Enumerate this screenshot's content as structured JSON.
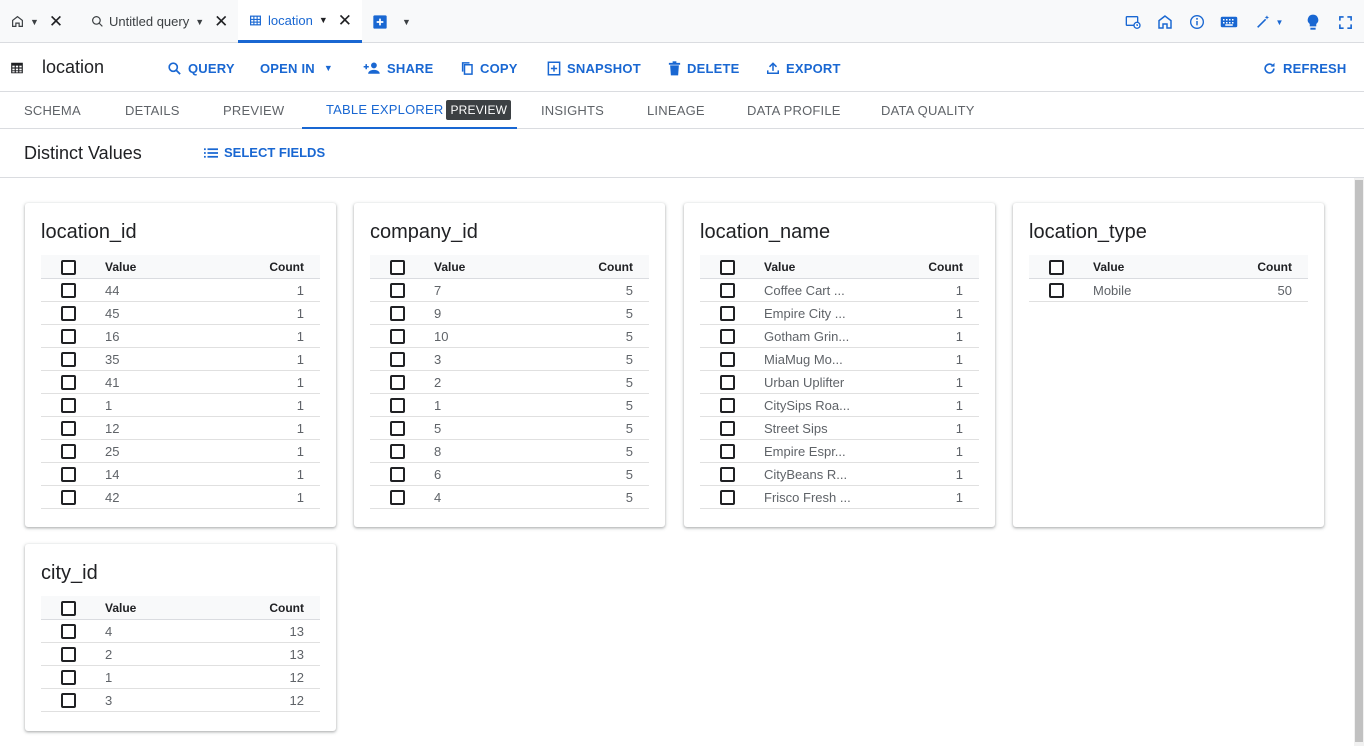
{
  "tabs": [
    {
      "label": "",
      "kind": "home"
    },
    {
      "label": "Untitled query",
      "kind": "query"
    },
    {
      "label": "location",
      "kind": "table",
      "active": true
    }
  ],
  "toolbar": {
    "title": "location",
    "buttons": {
      "query": "QUERY",
      "open_in": "OPEN IN",
      "share": "SHARE",
      "copy": "COPY",
      "snapshot": "SNAPSHOT",
      "delete": "DELETE",
      "export": "EXPORT",
      "refresh": "REFRESH"
    }
  },
  "subtabs": {
    "schema": "SCHEMA",
    "details": "DETAILS",
    "preview": "PREVIEW",
    "table_explorer": "TABLE EXPLORER",
    "table_explorer_badge": "PREVIEW",
    "insights": "INSIGHTS",
    "lineage": "LINEAGE",
    "data_profile": "DATA PROFILE",
    "data_quality": "DATA QUALITY"
  },
  "section": {
    "title": "Distinct Values",
    "select_fields": "SELECT FIELDS"
  },
  "table_headers": {
    "value": "Value",
    "count": "Count"
  },
  "cards": [
    {
      "title": "location_id",
      "rows": [
        {
          "value": "44",
          "count": "1"
        },
        {
          "value": "45",
          "count": "1"
        },
        {
          "value": "16",
          "count": "1"
        },
        {
          "value": "35",
          "count": "1"
        },
        {
          "value": "41",
          "count": "1"
        },
        {
          "value": "1",
          "count": "1"
        },
        {
          "value": "12",
          "count": "1"
        },
        {
          "value": "25",
          "count": "1"
        },
        {
          "value": "14",
          "count": "1"
        },
        {
          "value": "42",
          "count": "1"
        }
      ]
    },
    {
      "title": "company_id",
      "rows": [
        {
          "value": "7",
          "count": "5"
        },
        {
          "value": "9",
          "count": "5"
        },
        {
          "value": "10",
          "count": "5"
        },
        {
          "value": "3",
          "count": "5"
        },
        {
          "value": "2",
          "count": "5"
        },
        {
          "value": "1",
          "count": "5"
        },
        {
          "value": "5",
          "count": "5"
        },
        {
          "value": "8",
          "count": "5"
        },
        {
          "value": "6",
          "count": "5"
        },
        {
          "value": "4",
          "count": "5"
        }
      ]
    },
    {
      "title": "location_name",
      "rows": [
        {
          "value": "Coffee Cart ...",
          "count": "1"
        },
        {
          "value": "Empire City ...",
          "count": "1"
        },
        {
          "value": "Gotham Grin...",
          "count": "1"
        },
        {
          "value": "MiaMug Mo...",
          "count": "1"
        },
        {
          "value": "Urban Uplifter",
          "count": "1"
        },
        {
          "value": "CitySips Roa...",
          "count": "1"
        },
        {
          "value": "Street Sips",
          "count": "1"
        },
        {
          "value": "Empire Espr...",
          "count": "1"
        },
        {
          "value": "CityBeans R...",
          "count": "1"
        },
        {
          "value": "Frisco Fresh ...",
          "count": "1"
        }
      ]
    },
    {
      "title": "location_type",
      "rows": [
        {
          "value": "Mobile",
          "count": "50"
        }
      ]
    },
    {
      "title": "city_id",
      "rows": [
        {
          "value": "4",
          "count": "13"
        },
        {
          "value": "2",
          "count": "13"
        },
        {
          "value": "1",
          "count": "12"
        },
        {
          "value": "3",
          "count": "12"
        }
      ]
    }
  ],
  "colors": {
    "accent": "#1967d2",
    "text": "#202124",
    "muted": "#5f6368",
    "divider": "#dadce0"
  }
}
